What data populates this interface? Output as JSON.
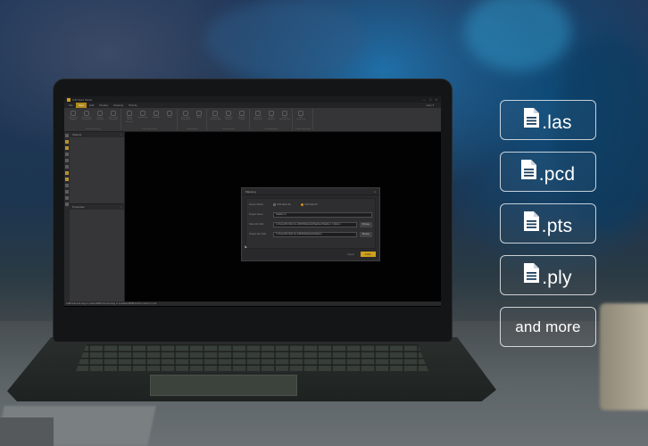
{
  "app": {
    "window_title": "K40 Stars Model",
    "window_buttons": [
      "—",
      "☐",
      "✕"
    ],
    "menu_tabs": [
      {
        "label": "File",
        "active": false
      },
      {
        "label": "Start",
        "active": true
      },
      {
        "label": "Edit",
        "active": false
      },
      {
        "label": "Display",
        "active": false
      },
      {
        "label": "Drawing",
        "active": false
      },
      {
        "label": "Plotcity",
        "active": false
      }
    ],
    "help_label": "Help ▾",
    "ribbon_groups": [
      {
        "label": "Data Processing",
        "items": [
          "Point Cloud Mapping",
          "Grid Model Registration",
          "Camera Calibration",
          "Point Cloud Colorization"
        ]
      },
      {
        "label": "Point Processing",
        "items": [
          "Moving Object Removal",
          "Simplification",
          "Rail Filter",
          "Ditch"
        ]
      },
      {
        "label": "Registration",
        "items": [
          "Point Cloud Registration",
          "Merge"
        ]
      },
      {
        "label": "Transformation",
        "items": [
          "Coordinate Transformation",
          "Translation Rotation",
          "Elevation Fitting"
        ]
      },
      {
        "label": "Quality Analysis",
        "items": [
          "Accuracy Verification",
          "Profile Analysis",
          "Volume Measurement"
        ]
      },
      {
        "label": "Project Templates",
        "items": [
          "Data Processing"
        ]
      }
    ],
    "panels": {
      "objects_title": "Objects",
      "properties_title": "Properties"
    },
    "status_text": "LMB:hold and drag to rotate;RMB:hold and drag to translate;MMB:Scroll to zoom in / out",
    "dialog": {
      "title": "Mapping",
      "close": "×",
      "device_model_label": "Device Model",
      "device_options": [
        {
          "label": "K40 Stars SL",
          "selected": false
        },
        {
          "label": "K40 Stars Pl",
          "selected": true
        }
      ],
      "project_name_label": "Project Name",
      "project_name_value": "Stadium 2",
      "data_file_path_label": "Data File Path",
      "data_file_path_value": "C:/Users/51-WH-CL-22000/Desktop/Stadium/Stadium 1.Dptem",
      "project_file_path_label": "Project File Path",
      "project_file_path_value": "C:/Users/51-WH-CL-22000/Desktop/Stadium",
      "browse_label": "Browse",
      "cancel_label": "Cancel",
      "finish_label": "Finish",
      "accent_color": "#e8b41c"
    }
  },
  "formats": [
    {
      "label": ".las",
      "icon": "document-icon"
    },
    {
      "label": ".pcd",
      "icon": "document-icon"
    },
    {
      "label": ".pts",
      "icon": "document-icon"
    },
    {
      "label": ".ply",
      "icon": "document-icon"
    },
    {
      "label": "and more",
      "icon": null
    }
  ]
}
